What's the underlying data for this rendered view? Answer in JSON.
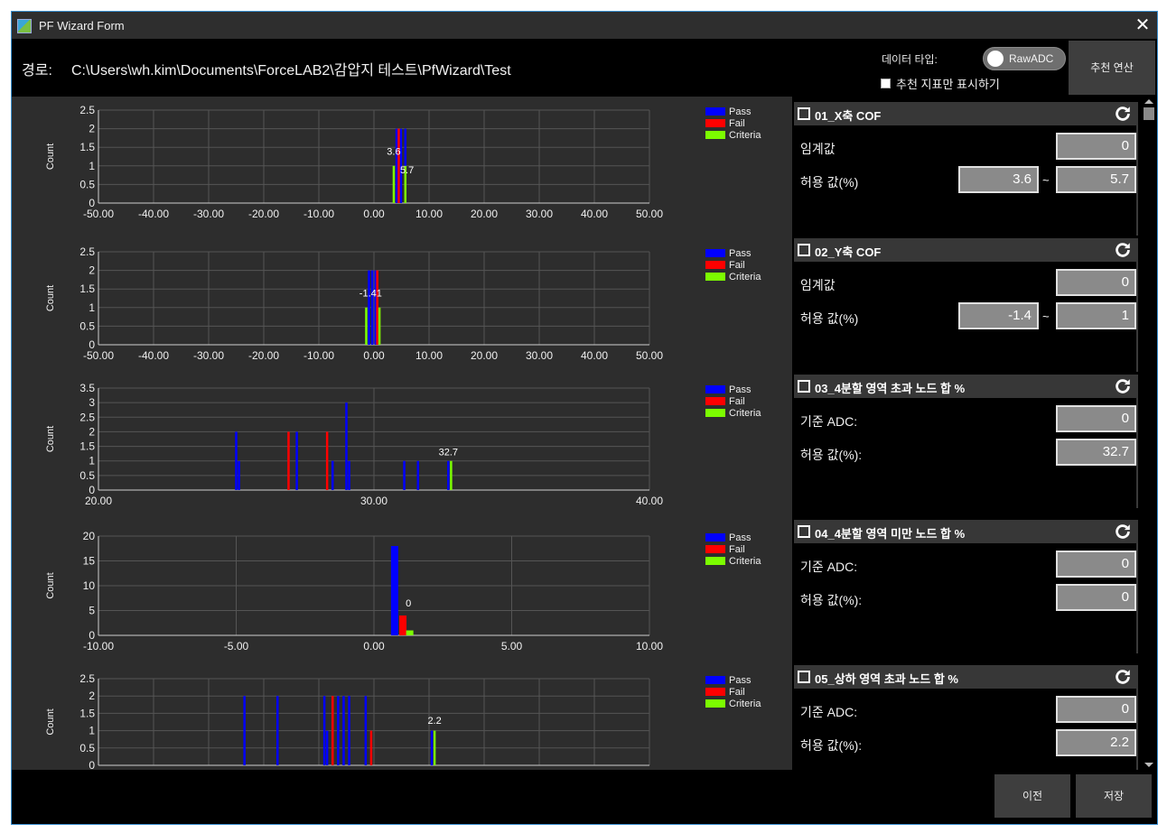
{
  "window": {
    "title": "PF Wizard Form",
    "close_glyph": "✕"
  },
  "header": {
    "path_label": "경로:",
    "path_value": "C:\\Users\\wh.kim\\Documents\\ForceLAB2\\감압지 테스트\\PfWizard\\Test",
    "data_type_label": "데이터 타입:",
    "toggle_value": "RawADC",
    "recommended_only_label": "추천 지표만 표시하기",
    "recommended_only_checked": false,
    "calc_button": "추천 연산"
  },
  "legend": [
    "Pass",
    "Fail",
    "Criteria"
  ],
  "colors": {
    "pass": "#0000ff",
    "fail": "#ff0000",
    "criteria": "#7cfc00",
    "purple": "#a000c8",
    "orange": "#ffa500"
  },
  "chart_data": [
    {
      "type": "bar",
      "ylabel": "Count",
      "ylim": [
        0,
        2.5
      ],
      "yticks": [
        "2.5",
        "2",
        "1.5",
        "1",
        "0.5",
        "0"
      ],
      "xlim": [
        -50,
        50
      ],
      "xticks": [
        "-50.00",
        "-40.00",
        "-30.00",
        "-20.00",
        "-10.00",
        "0.00",
        "10.00",
        "20.00",
        "30.00",
        "40.00",
        "50.00"
      ],
      "series": [
        {
          "name": "Pass",
          "points": [
            [
              4.1,
              2
            ],
            [
              4.9,
              2
            ],
            [
              5.7,
              2
            ]
          ]
        },
        {
          "name": "Fail",
          "points": [
            [
              4.5,
              2
            ]
          ]
        },
        {
          "name": "Criteria",
          "points": [
            [
              3.6,
              1
            ],
            [
              5.7,
              1
            ]
          ]
        }
      ],
      "annotations": [
        {
          "x": 3.6,
          "y": 1.3,
          "text": "3.6"
        },
        {
          "x": 6.0,
          "y": 0.8,
          "text": "5.7"
        }
      ]
    },
    {
      "type": "bar",
      "ylabel": "Count",
      "ylim": [
        0,
        2.5
      ],
      "yticks": [
        "2.5",
        "2",
        "1.5",
        "1",
        "0.5",
        "0"
      ],
      "xlim": [
        -50,
        50
      ],
      "xticks": [
        "-50.00",
        "-40.00",
        "-30.00",
        "-20.00",
        "-10.00",
        "0.00",
        "10.00",
        "20.00",
        "30.00",
        "40.00",
        "50.00"
      ],
      "series": [
        {
          "name": "Pass",
          "points": [
            [
              -0.9,
              2
            ],
            [
              -0.3,
              2
            ],
            [
              0.3,
              2
            ]
          ]
        },
        {
          "name": "Fail",
          "points": [
            [
              0.6,
              2
            ]
          ]
        },
        {
          "name": "Criteria",
          "points": [
            [
              -1.4,
              1
            ],
            [
              1.0,
              1
            ]
          ]
        }
      ],
      "annotations": [
        {
          "x": -0.6,
          "y": 1.3,
          "text": "-1.41"
        }
      ]
    },
    {
      "type": "bar",
      "ylabel": "Count",
      "ylim": [
        0,
        3.5
      ],
      "yticks": [
        "3.5",
        "3",
        "2.5",
        "2",
        "1.5",
        "1",
        "0.5",
        "0"
      ],
      "xlim": [
        20,
        40
      ],
      "xticks": [
        "20.00",
        "30.00",
        "40.00"
      ],
      "series": [
        {
          "name": "Pass",
          "points": [
            [
              25.0,
              2
            ],
            [
              25.1,
              1
            ],
            [
              27.2,
              2
            ],
            [
              28.5,
              1
            ],
            [
              29.0,
              3
            ],
            [
              29.1,
              1
            ],
            [
              31.1,
              1
            ],
            [
              31.6,
              1
            ],
            [
              32.7,
              1
            ]
          ]
        },
        {
          "name": "Fail",
          "points": [
            [
              26.9,
              2
            ],
            [
              28.3,
              2
            ]
          ]
        },
        {
          "name": "Criteria",
          "points": [
            [
              32.8,
              1
            ]
          ]
        }
      ],
      "annotations": [
        {
          "x": 32.7,
          "y": 1.2,
          "text": "32.7"
        }
      ]
    },
    {
      "type": "bar",
      "ylabel": "Count",
      "ylim": [
        0,
        20
      ],
      "yticks": [
        "20",
        "15",
        "10",
        "5",
        "0"
      ],
      "xlim": [
        -10,
        10
      ],
      "xticks": [
        "-10.00",
        "-5.00",
        "0.00",
        "5.00",
        "10.00"
      ],
      "series": [
        {
          "name": "Pass",
          "points": [
            [
              0.75,
              18
            ]
          ]
        },
        {
          "name": "Fail",
          "points": [
            [
              1.05,
              4
            ]
          ]
        },
        {
          "name": "Criteria",
          "points": [
            [
              1.3,
              1
            ]
          ]
        }
      ],
      "annotations": [
        {
          "x": 1.25,
          "y": 5.8,
          "text": "0"
        }
      ]
    },
    {
      "type": "bar",
      "ylabel": "Count",
      "ylim": [
        0,
        2.5
      ],
      "yticks": [
        "2.5",
        "2",
        "1.5",
        "1",
        "0.5",
        "0"
      ],
      "xlim": [
        -10,
        10
      ],
      "xticks": [],
      "series": [
        {
          "name": "Pass",
          "points": [
            [
              -4.7,
              2
            ],
            [
              -3.5,
              2
            ],
            [
              -1.8,
              2
            ],
            [
              -1.7,
              1
            ],
            [
              -1.3,
              2
            ],
            [
              -1.1,
              2
            ],
            [
              -0.9,
              2
            ],
            [
              -0.3,
              2
            ],
            [
              2.1,
              1
            ]
          ]
        },
        {
          "name": "Fail",
          "points": [
            [
              -1.5,
              2
            ],
            [
              -0.1,
              1
            ]
          ]
        },
        {
          "name": "Criteria",
          "points": [
            [
              2.2,
              1
            ]
          ]
        }
      ],
      "annotations": [
        {
          "x": 2.2,
          "y": 1.2,
          "text": "2.2"
        }
      ]
    }
  ],
  "cards": [
    {
      "title": "01_X축 COF",
      "label1": "임계값",
      "value1": "0",
      "label2": "허용 값(%)",
      "range": true,
      "min": "3.6",
      "max": "5.7"
    },
    {
      "title": "02_Y축 COF",
      "label1": "임계값",
      "value1": "0",
      "label2": "허용 값(%)",
      "range": true,
      "min": "-1.4",
      "max": "1"
    },
    {
      "title": "03_4분할 영역 초과 노드 합 %",
      "label1": "기준 ADC:",
      "value1": "0",
      "label2": "허용 값(%):",
      "range": false,
      "max": "32.7"
    },
    {
      "title": "04_4분할 영역 미만 노드 합 %",
      "label1": "기준 ADC:",
      "value1": "0",
      "label2": "허용 값(%):",
      "range": false,
      "max": "0"
    },
    {
      "title": "05_상하 영역 초과 노드 합 %",
      "label1": "기준 ADC:",
      "value1": "0",
      "label2": "허용 값(%):",
      "range": false,
      "max": "2.2"
    }
  ],
  "footer": {
    "prev_button": "이전",
    "save_button": "저장"
  }
}
